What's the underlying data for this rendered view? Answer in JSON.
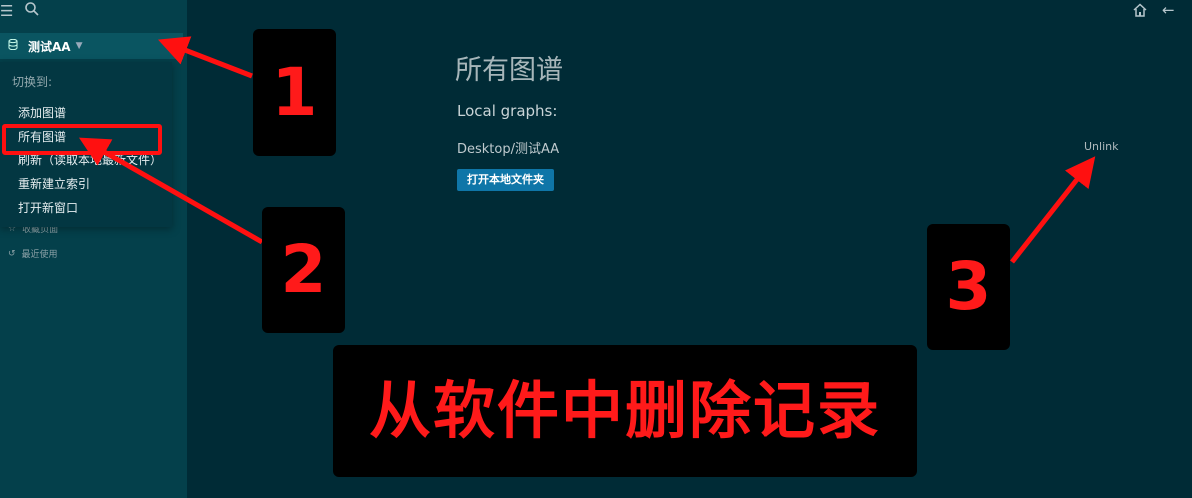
{
  "sidebar": {
    "graph_name": "测试AA",
    "dropdown": {
      "switch_label": "切换到:",
      "items": [
        "添加图谱",
        "所有图谱",
        "刷新（读取本地最新文件）",
        "重新建立索引",
        "打开新窗口"
      ]
    },
    "favorites_label": "收藏页面",
    "recent_label": "最近使用"
  },
  "main": {
    "title": "所有图谱",
    "local_graphs_label": "Local graphs:",
    "graph_path": "Desktop/测试AA",
    "open_button": "打开本地文件夹",
    "unlink_label": "Unlink"
  },
  "annotations": {
    "badge_1": "1",
    "badge_2": "2",
    "badge_3": "3",
    "banner": "从软件中删除记录"
  },
  "colors": {
    "background": "#002b36",
    "sidebar": "#04404b",
    "accent_button": "#0f76a8",
    "annotation_red": "#ff1a1a"
  },
  "icons": [
    "menu-icon",
    "search-icon",
    "database-icon",
    "chevron-down-icon",
    "star-icon",
    "history-icon",
    "home-icon",
    "arrow-left-icon"
  ]
}
